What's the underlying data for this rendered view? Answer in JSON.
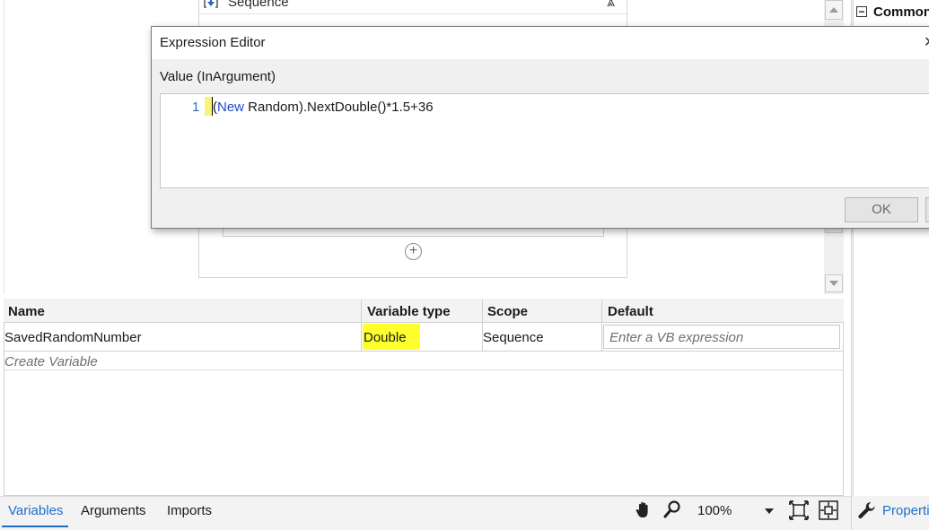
{
  "designer": {
    "sequence_title": "Sequence"
  },
  "properties_panel": {
    "section_label": "Common",
    "tab_label": "Properti"
  },
  "expression_editor": {
    "title": "Expression Editor",
    "value_label": "Value (InArgument)",
    "line_number": "1",
    "code_open": "(",
    "code_keyword": "New",
    "code_rest": " Random).NextDouble()*1.5+36",
    "ok_label": "OK"
  },
  "variables_grid": {
    "columns": [
      "Name",
      "Variable type",
      "Scope",
      "Default"
    ],
    "rows": [
      {
        "name": "SavedRandomNumber",
        "type": "Double",
        "scope": "Sequence",
        "default_placeholder": "Enter a VB expression"
      }
    ],
    "create_placeholder": "Create Variable",
    "highlight_color": "#ffff2e"
  },
  "bottom_bar": {
    "tabs": [
      "Variables",
      "Arguments",
      "Imports"
    ],
    "active_tab": "Variables",
    "zoom": "100%",
    "accent_color": "#1e6fc7"
  },
  "icons": {
    "sequence": "sequence-icon",
    "collapse": "collapse-chevron-icon",
    "add": "add-activity-icon",
    "hand": "hand-pan-icon",
    "zoom": "magnifier-icon",
    "fit": "fit-to-screen-icon",
    "overview": "overview-icon",
    "wrench": "wrench-icon"
  }
}
